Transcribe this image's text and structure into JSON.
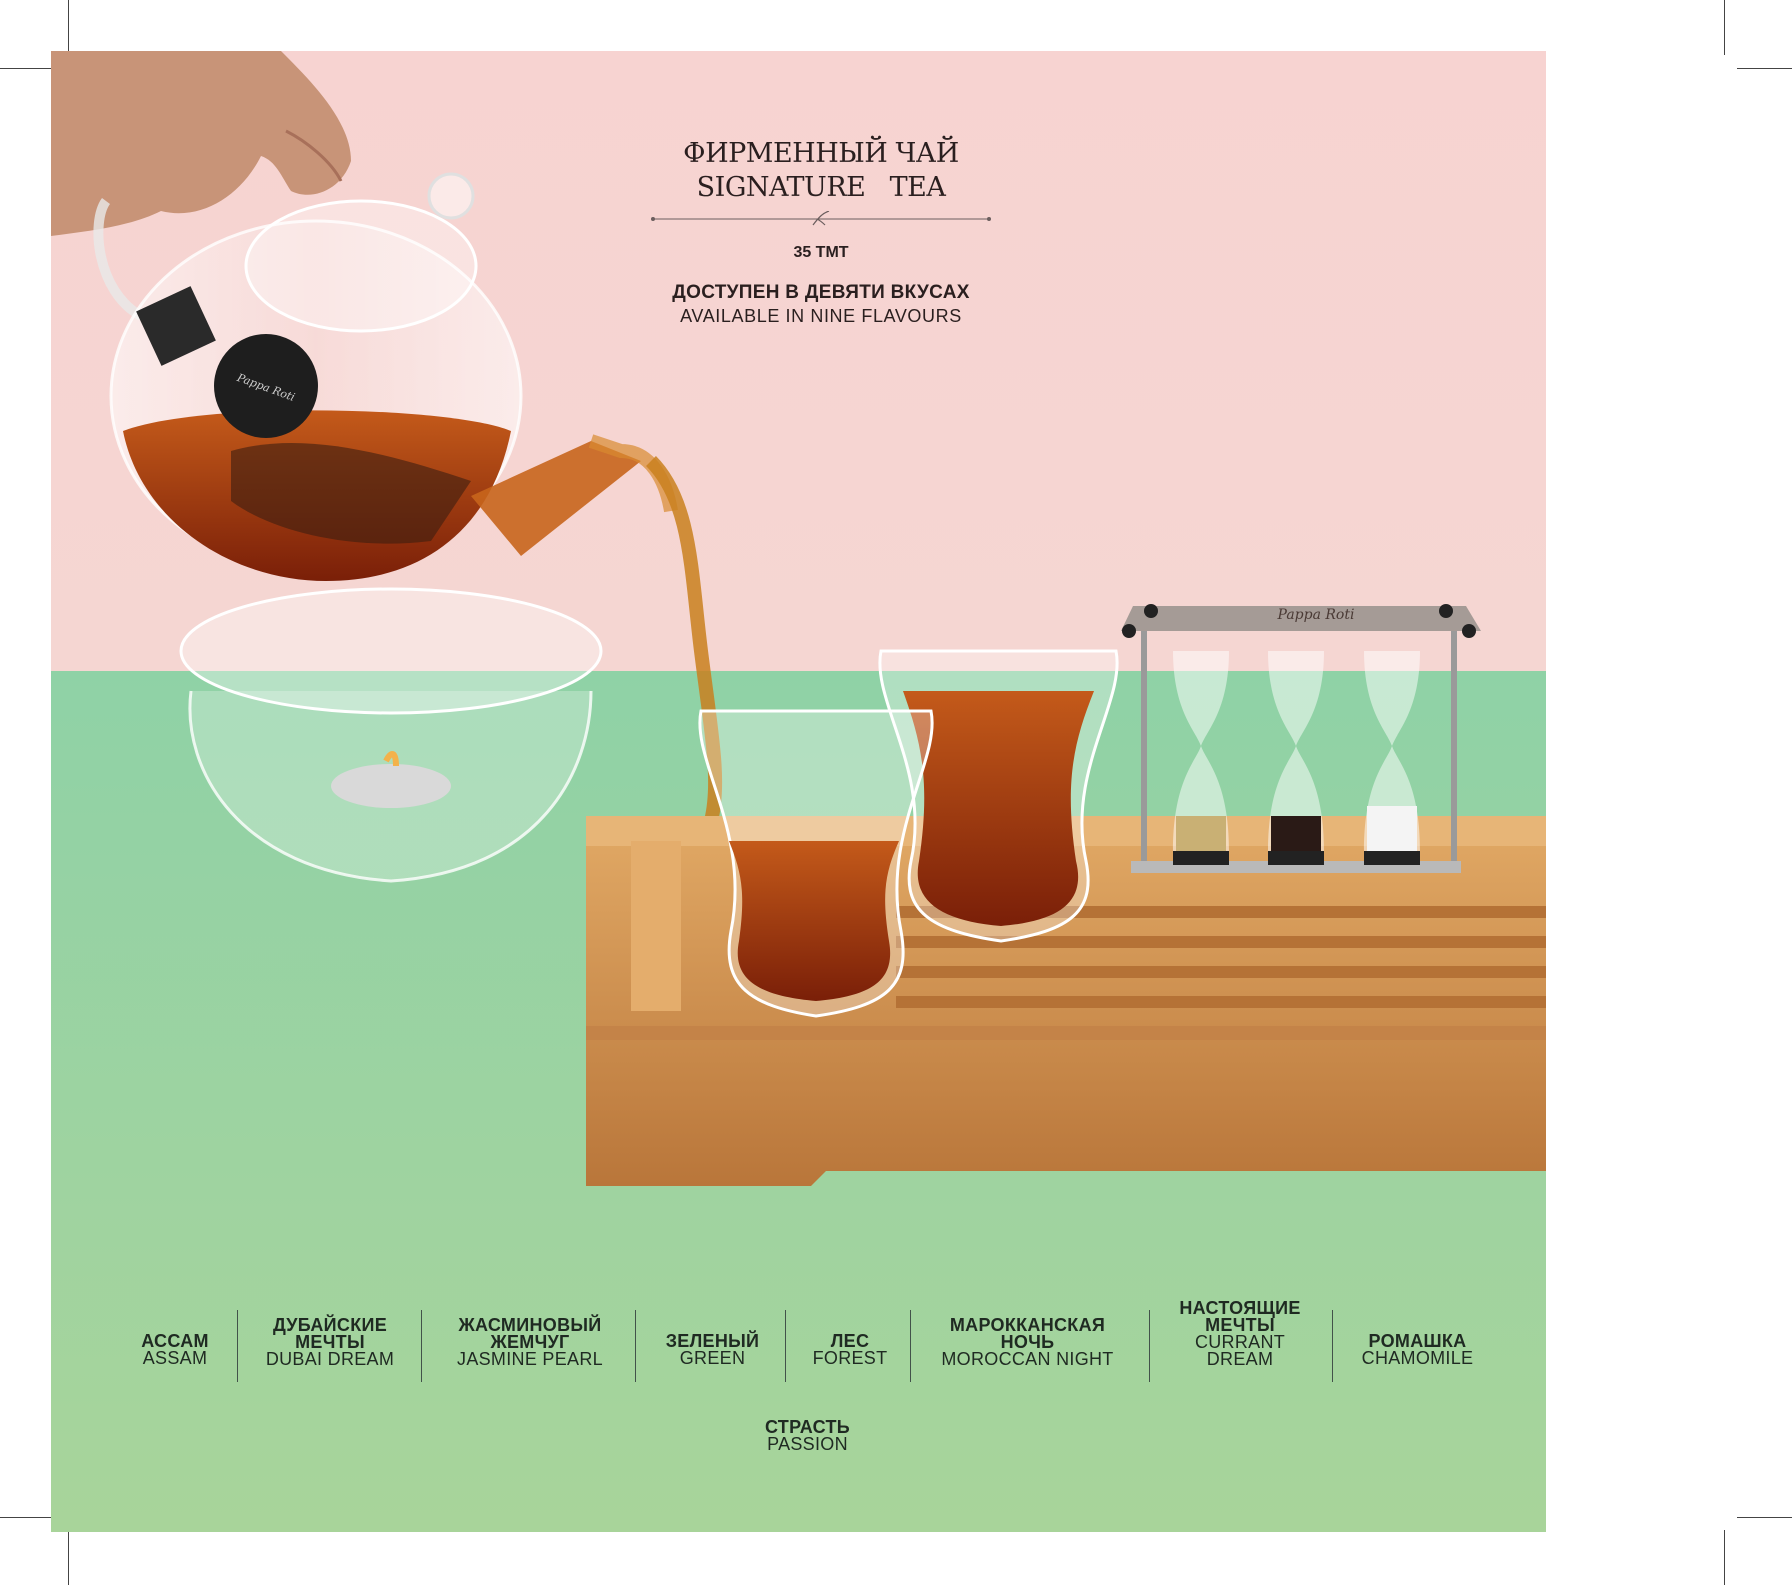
{
  "title": {
    "ru": "ФИРМЕННЫЙ ЧАЙ",
    "en": "SIGNATURE   TEA"
  },
  "price": "35 ТМТ",
  "availability": {
    "ru": "ДОСТУПЕН В ДЕВЯТИ ВКУСАХ",
    "en": "AVAILABLE IN NINE FLAVOURS"
  },
  "hourglass_brand": "Pappa Roti",
  "teapot_label": "Pappa Roti",
  "flavours": [
    {
      "ru": "АССАМ",
      "en": "ASSAM"
    },
    {
      "ru": "ДУБАЙСКИЕ МЕЧТЫ",
      "en": "DUBAI DREAM"
    },
    {
      "ru": "ЖАСМИНОВЫЙ ЖЕМЧУГ",
      "en": "JASMINE PEARL"
    },
    {
      "ru": "ЗЕЛЕНЫЙ",
      "en": "GREEN"
    },
    {
      "ru": "ЛЕС",
      "en": "FOREST"
    },
    {
      "ru": "МАРОККАНСКАЯ НОЧЬ",
      "en": "MOROCCAN NIGHT"
    },
    {
      "ru": "НАСТОЯЩИЕ МЕЧТЫ",
      "en": "CURRANT DREAM"
    },
    {
      "ru": "РОМАШКА",
      "en": "CHAMOMILE"
    },
    {
      "ru": "СТРАСТЬ",
      "en": "PASSION"
    }
  ],
  "colors": {
    "wall": "#f6d4d2",
    "table": "#9dd3a3",
    "tea": "#a8360f",
    "bamboo": "#d59b5a",
    "text": "#231f20"
  }
}
